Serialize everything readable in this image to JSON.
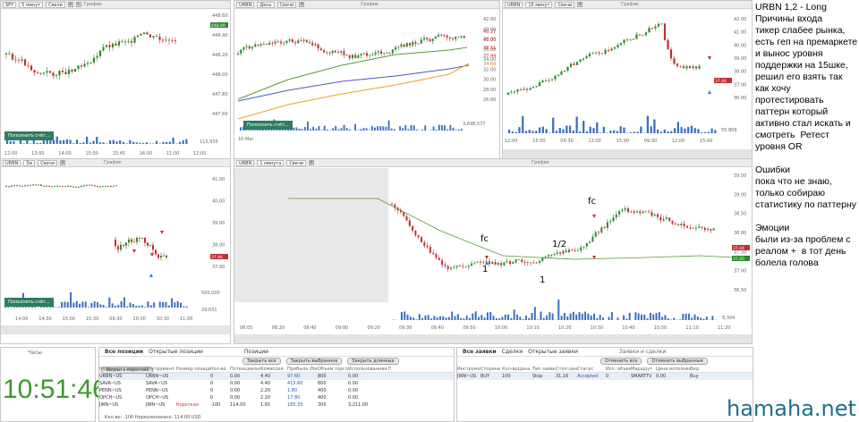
{
  "annotation": {
    "lines": [
      "URBN 1,2 - Long",
      "Причины входа",
      "тикер слабее рынка,",
      "есть гeп на премаркете",
      "и вынос уровня",
      "поддержки на 15шке,",
      "решил его взять так",
      "как хочу",
      "протестировать",
      "паттерн который",
      "активно стал искать и",
      "смотреть  Ретест",
      "уровня OR",
      "",
      "Ошибки",
      "пока что не знаю,",
      "только собираю",
      "статистику по паттерну",
      "",
      "Эмоции",
      "были из-за проблем с",
      "реалом +  в тот день",
      "болела голова"
    ]
  },
  "charts": {
    "spy": {
      "symbol": "SPY",
      "interval": "5 минут",
      "type": "Свечи",
      "graph_label": "График",
      "yticks": [
        "448.60",
        "448.40",
        "448.20",
        "448.00",
        "447.80",
        "447.60"
      ],
      "last_price": "448.49",
      "volume": "115,935",
      "xticks": [
        "12:00",
        "13:00",
        "14:00",
        "15:00",
        "15:45",
        "16:00",
        "11:00",
        "12:00"
      ]
    },
    "urbn_day": {
      "symbol": "URBN",
      "interval": "День",
      "type": "Свечи",
      "graph_label": "График",
      "yticks": [
        "42.00",
        "40.00",
        "38.00",
        "36.00",
        "34.00",
        "32.00",
        "30.00",
        "28.00",
        "26.00"
      ],
      "price_tags": [
        "40.27",
        "40.00",
        "38.51",
        "37.44",
        "34.69"
      ],
      "volume": "3,698,577",
      "date_label": "10 Мar"
    },
    "urbn_15m": {
      "symbol": "URBN",
      "interval": "15 минут",
      "type": "Свечи",
      "graph_label": "График",
      "yticks": [
        "42.00",
        "41.00",
        "40.00",
        "39.00",
        "38.00",
        "37.00",
        "36.00"
      ],
      "last_price": "37.44",
      "volume": "55,809",
      "xticks": [
        "12:00",
        "15:00",
        "09:30",
        "12:00",
        "15:00",
        "09:30",
        "12:00",
        "15:00"
      ]
    },
    "urbn_5m": {
      "symbol": "URBN",
      "interval": "5м",
      "type": "Свечи",
      "graph_label": "График",
      "yticks": [
        "41.00",
        "40.00",
        "39.00",
        "38.00",
        "37.00"
      ],
      "last_price": "37.44",
      "volume": "29,631",
      "vol_scale": "500,000",
      "xticks": [
        "14:00",
        "14:30",
        "15:00",
        "15:30",
        "09:30",
        "10:00",
        "10:30",
        "11:00"
      ]
    },
    "urbn_1m": {
      "symbol": "URBN",
      "interval": "1 минута",
      "type": "Свечи",
      "graph_label": "График",
      "yticks": [
        "39.50",
        "39.00",
        "38.50",
        "38.00",
        "37.50",
        "37.00",
        "36.50"
      ],
      "last_price": "37.44",
      "price_tag2": "37.20",
      "volume": "8,304",
      "xticks": [
        "08:05",
        "08:20",
        "08:40",
        "09:00",
        "09:20",
        "09:30",
        "09:40",
        "09:50",
        "10:00",
        "10:10",
        "10:20",
        "10:30",
        "10:40",
        "10:50",
        "11:10",
        "11:20"
      ],
      "annotations": [
        "fc",
        "1",
        "1/2",
        "1",
        "fc"
      ]
    },
    "fill_button": "Пополнить счёт..."
  },
  "clock": {
    "title": "Часы",
    "time": "10:51:46"
  },
  "positions": {
    "tabs": [
      "Все позиции",
      "Открытые позиции",
      "Позиции"
    ],
    "buttons": [
      "Закрыть все",
      "Закрыть выбранное",
      "Закрыть длинные",
      "Закрыть короткие"
    ],
    "headers": [
      "Название компании",
      "Инструмент",
      "Размер позиции",
      "Кол-во",
      "Потенциальная",
      "Комиссия",
      "Прибыль (Net)",
      "Объем торгов",
      "Использованная ПС"
    ],
    "rows": [
      [
        "URBN~US",
        "URBN~US",
        "",
        "0",
        "0.00",
        "4.40",
        "97.60",
        "800",
        "0.00"
      ],
      [
        "SAVA~US",
        "SAVA~US",
        "",
        "0",
        "0.00",
        "4.40",
        "415.60",
        "800",
        "0.00"
      ],
      [
        "PENN~US",
        "PENN~US",
        "",
        "0",
        "0.00",
        "2.20",
        "1.80",
        "400",
        "0.00"
      ],
      [
        "OPCH~US",
        "OPCH~US",
        "",
        "0",
        "0.00",
        "2.20",
        "17.80",
        "400",
        "0.00"
      ],
      [
        "JWN~US",
        "JWN~US",
        "Короткая",
        "-100",
        "114.00",
        "1.65",
        "185.35",
        "300",
        "3,211.00"
      ]
    ],
    "footer": "Кол-во: -100   Нереализовано: 114.00 USD"
  },
  "orders": {
    "tabs": [
      "Все заявки",
      "Сделки",
      "Открытые заявки"
    ],
    "title": "Заявки и сделки",
    "buttons": [
      "Отменить все",
      "Отменить выбранные"
    ],
    "headers": [
      "Инструмент",
      "Сторона",
      "Кол-во",
      "Цена",
      "Тип заявки",
      "Стоп цена",
      "Статус",
      "Исп. объем",
      "Маршрут",
      "Цена исполнения",
      "Вид"
    ],
    "rows": [
      [
        "JWN~US",
        "BUY",
        "100",
        "",
        "Stop",
        "31.16",
        "Accepted",
        "0",
        "SMARTTV",
        "0.00",
        "Buy"
      ]
    ]
  },
  "watermark": "hamaha.net"
}
